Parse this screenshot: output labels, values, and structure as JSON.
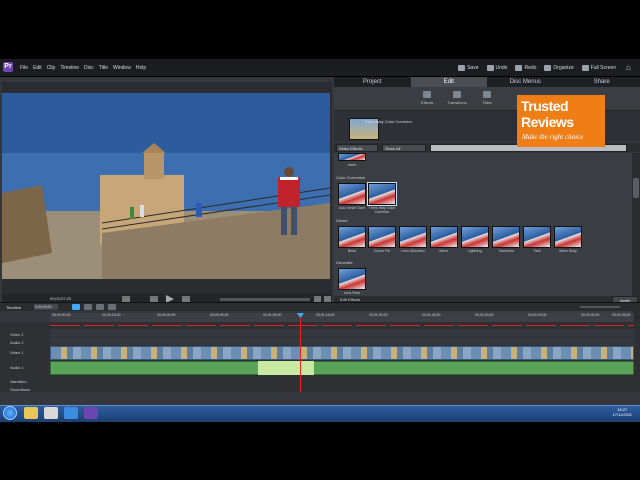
{
  "titlebar": {
    "menus": [
      "File",
      "Edit",
      "Clip",
      "Timeline",
      "Disc",
      "Title",
      "Window",
      "Help"
    ],
    "buttons": [
      "Save",
      "Undo",
      "Redo",
      "Organize",
      "Full Screen"
    ]
  },
  "panel_tabs": [
    "Project",
    "Edit",
    "Disc Menus",
    "Share"
  ],
  "sub_tabs": [
    "Effects",
    "Transitions",
    "Titles"
  ],
  "preview": {
    "effect_name": "Three-Way Color Corrector"
  },
  "filters": {
    "category": "Video Effects",
    "view": "Show All"
  },
  "effects": {
    "top_item": "Invert",
    "color_correction": {
      "label": "Color Correction",
      "items": [
        "Auto Smart Tone",
        "Three-Way Color Corrector"
      ]
    },
    "distort": {
      "label": "Distort",
      "items": [
        "Bend",
        "Corner Pin",
        "Lens Distortion",
        "Mirror",
        "Lightning",
        "Transform",
        "Twirl",
        "Wave Warp"
      ]
    },
    "generate": {
      "label": "Generate",
      "items": [
        "Lens Flare"
      ]
    }
  },
  "effects_toolbar": {
    "edit_label": "Edit Effects",
    "apply_label": "Apply"
  },
  "monitor": {
    "timecode": "00;02;07;20"
  },
  "timeline": {
    "label": "Timeline",
    "position": "0;00;00;00",
    "ruler": [
      "00;00;00;00",
      "00;00;15;00",
      "00;00;30;00",
      "00;00;45;00",
      "00;01;00;00",
      "00;01;15;00",
      "00;01;30;00",
      "00;01;45;00",
      "00;02;00;00",
      "00;02;15;00",
      "00;02;30;00",
      "00;02;45;00"
    ],
    "tracks": [
      "Video 2",
      "Audio 2",
      "Video 1",
      "Audio 1",
      "Narration",
      "Soundtrack"
    ]
  },
  "taskbar": {
    "time": "16:27",
    "date": "17/11/2011"
  },
  "watermark": {
    "line1": "Trusted",
    "line2": "Reviews",
    "tagline": "Make the right choice"
  }
}
